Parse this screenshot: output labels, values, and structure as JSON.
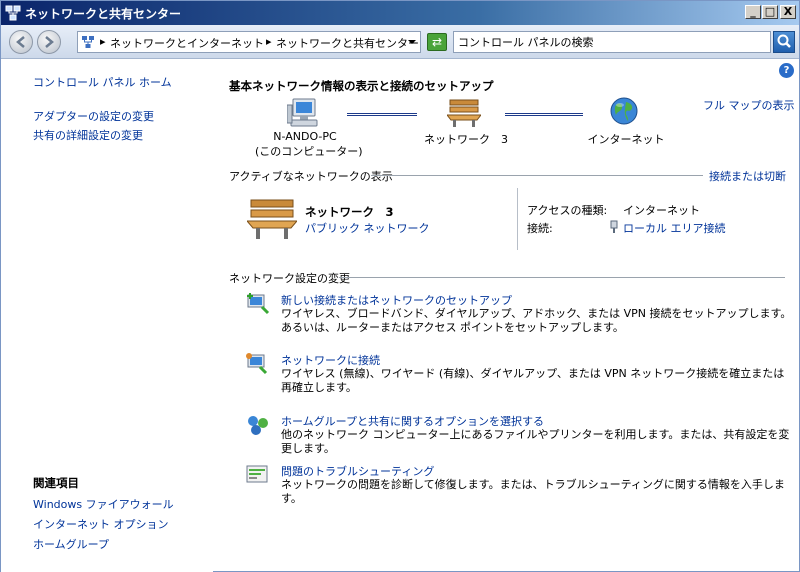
{
  "window": {
    "title": "ネットワークと共有センター",
    "controls": {
      "minimize": "_",
      "maximize": "□",
      "close": "X"
    }
  },
  "address_bar": {
    "crumbs": [
      "ネットワークとインターネット",
      "ネットワークと共有センター"
    ],
    "search_placeholder": "コントロール パネルの検索"
  },
  "left_panel": {
    "home": "コントロール パネル ホーム",
    "links": [
      "アダプターの設定の変更",
      "共有の詳細設定の変更"
    ],
    "related_heading": "関連項目",
    "related": [
      "Windows ファイアウォール",
      "インターネット オプション",
      "ホームグループ"
    ]
  },
  "main": {
    "help": "?",
    "heading": "基本ネットワーク情報の表示と接続のセットアップ",
    "full_map": "フル マップの表示",
    "map": {
      "computer_line1": "N-ANDO-PC",
      "computer_line2": "(このコンピューター)",
      "network": "ネットワーク　3",
      "internet": "インターネット"
    },
    "active": {
      "section": "アクティブなネットワークの表示",
      "connect_link": "接続または切断",
      "network_name": "ネットワーク　3",
      "network_type": "パブリック ネットワーク",
      "access_label": "アクセスの種類:",
      "access_value": "インターネット",
      "conn_label": "接続:",
      "conn_value": "ローカル エリア接続"
    },
    "change_settings": {
      "section": "ネットワーク設定の変更",
      "tasks": [
        {
          "link": "新しい接続またはネットワークのセットアップ",
          "desc": "ワイヤレス、ブロードバンド、ダイヤルアップ、アドホック、または VPN 接続をセットアップします。あるいは、ルーターまたはアクセス ポイントをセットアップします。"
        },
        {
          "link": "ネットワークに接続",
          "desc": "ワイヤレス (無線)、ワイヤード (有線)、ダイヤルアップ、または VPN ネットワーク接続を確立または再確立します。"
        },
        {
          "link": "ホームグループと共有に関するオプションを選択する",
          "desc": "他のネットワーク コンピューター上にあるファイルやプリンターを利用します。または、共有設定を変更します。"
        },
        {
          "link": "問題のトラブルシューティング",
          "desc": "ネットワークの問題を診断して修復します。または、トラブルシューティングに関する情報を入手します。"
        }
      ]
    }
  },
  "colors": {
    "link": "#003399",
    "title_bar": "#0a246a"
  }
}
